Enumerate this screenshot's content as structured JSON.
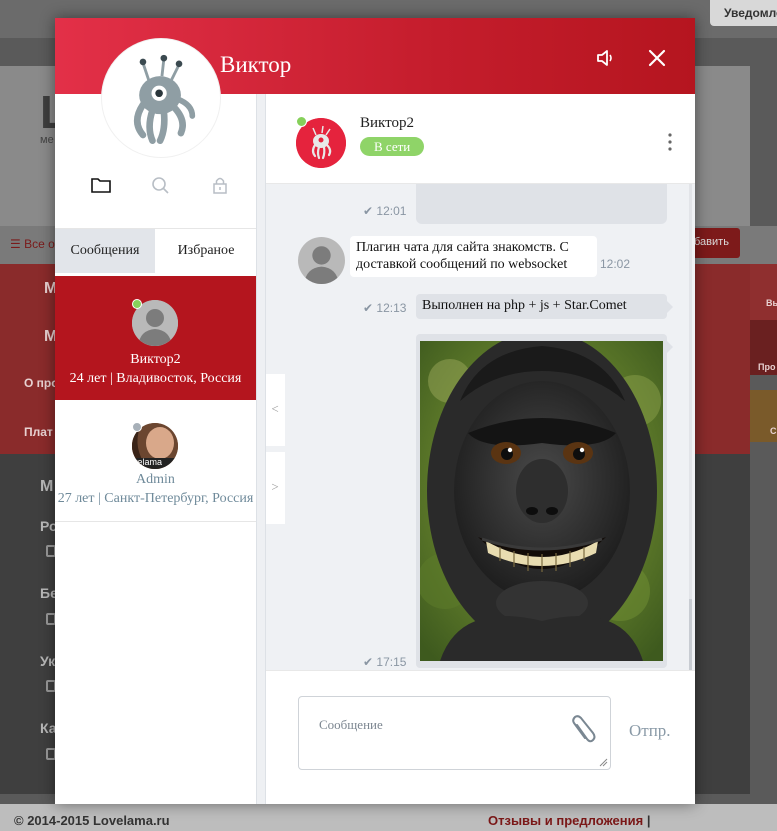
{
  "background": {
    "notify_label": "Уведомления",
    "logo": "L",
    "logo_sub": "ме",
    "all_label": "Все о",
    "add_label": "бавить",
    "red_items": [
      "М",
      "М",
      "О про",
      "Плат"
    ],
    "dark_items": [
      "М",
      "Ро",
      "Бе",
      "Ук",
      "Ка"
    ],
    "side_labels": [
      "Вы",
      "Про",
      "С"
    ],
    "copyright": "© 2014-2015 Lovelama.ru",
    "feedback": "Отзывы и предложения",
    "feedback_sep": "|"
  },
  "modal": {
    "title": "Виктор",
    "sound_icon": "speaker-icon",
    "close_icon": "close-icon",
    "header_gradient": [
      "#e33048",
      "#b5151f"
    ]
  },
  "left": {
    "icons": [
      "folder-icon",
      "search-icon",
      "lock-icon"
    ],
    "tabs": [
      {
        "label": "Сообщения",
        "active": true
      },
      {
        "label": "Избраное",
        "active": false
      }
    ],
    "contacts": [
      {
        "name": "Виктор2",
        "info": "24 лет | Владивосток, Россия",
        "online": true,
        "active": true
      },
      {
        "name": "Admin",
        "info": "27 лет | Санкт-Петербург, Россия",
        "online": false,
        "active": false,
        "avatar_text": "velama"
      }
    ]
  },
  "chat": {
    "contact_name": "Виктор2",
    "status": "В сети",
    "status_color": "#8fd468",
    "prev_arrow": "<",
    "next_arrow": ">",
    "messages": [
      {
        "dir": "out",
        "time": "12:01",
        "text": ""
      },
      {
        "dir": "in",
        "time": "12:02",
        "text": "Плагин чата для сайта знакомств. С доставкой сообщений по websocket"
      },
      {
        "dir": "out",
        "time": "12:13",
        "text": "Выполнен на php + js + Star.Comet"
      },
      {
        "dir": "out",
        "time": "17:15",
        "image": "monkey-selfie"
      }
    ],
    "input_placeholder": "Сообщение",
    "send_label": "Отпр."
  }
}
